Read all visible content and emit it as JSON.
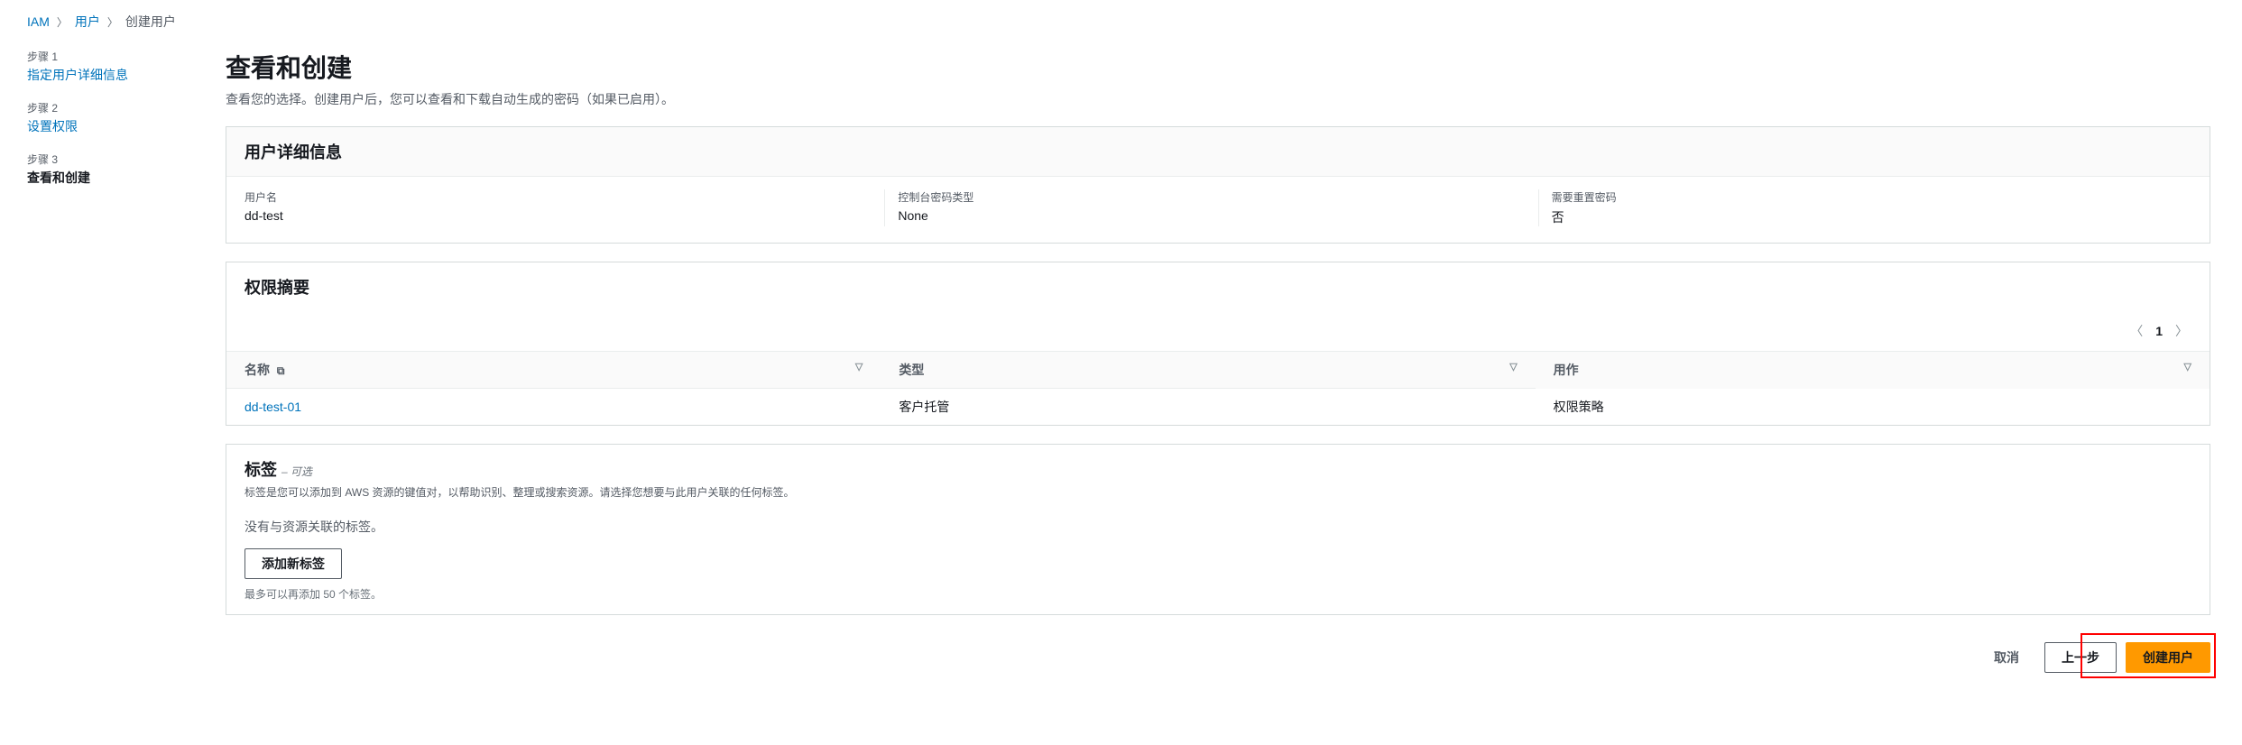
{
  "breadcrumb": {
    "root": "IAM",
    "parent": "用户",
    "current": "创建用户"
  },
  "steps": [
    {
      "label": "步骤 1",
      "title": "指定用户详细信息"
    },
    {
      "label": "步骤 2",
      "title": "设置权限"
    },
    {
      "label": "步骤 3",
      "title": "查看和创建"
    }
  ],
  "page": {
    "title": "查看和创建",
    "subtitle": "查看您的选择。创建用户后，您可以查看和下载自动生成的密码（如果已启用）。"
  },
  "userDetails": {
    "title": "用户详细信息",
    "cols": [
      {
        "label": "用户名",
        "value": "dd-test"
      },
      {
        "label": "控制台密码类型",
        "value": "None"
      },
      {
        "label": "需要重置密码",
        "value": "否"
      }
    ]
  },
  "permissions": {
    "title": "权限摘要",
    "pagination": {
      "page": "1"
    },
    "columns": {
      "name": "名称",
      "type": "类型",
      "usage": "用作"
    },
    "rows": [
      {
        "name": "dd-test-01",
        "type": "客户托管",
        "usage": "权限策略"
      }
    ]
  },
  "tags": {
    "title": "标签",
    "optional": "– 可选",
    "subtitle": "标签是您可以添加到 AWS 资源的键值对，以帮助识别、整理或搜索资源。请选择您想要与此用户关联的任何标签。",
    "empty": "没有与资源关联的标签。",
    "addButton": "添加新标签",
    "hint": "最多可以再添加 50 个标签。"
  },
  "footer": {
    "cancel": "取消",
    "previous": "上一步",
    "create": "创建用户"
  }
}
